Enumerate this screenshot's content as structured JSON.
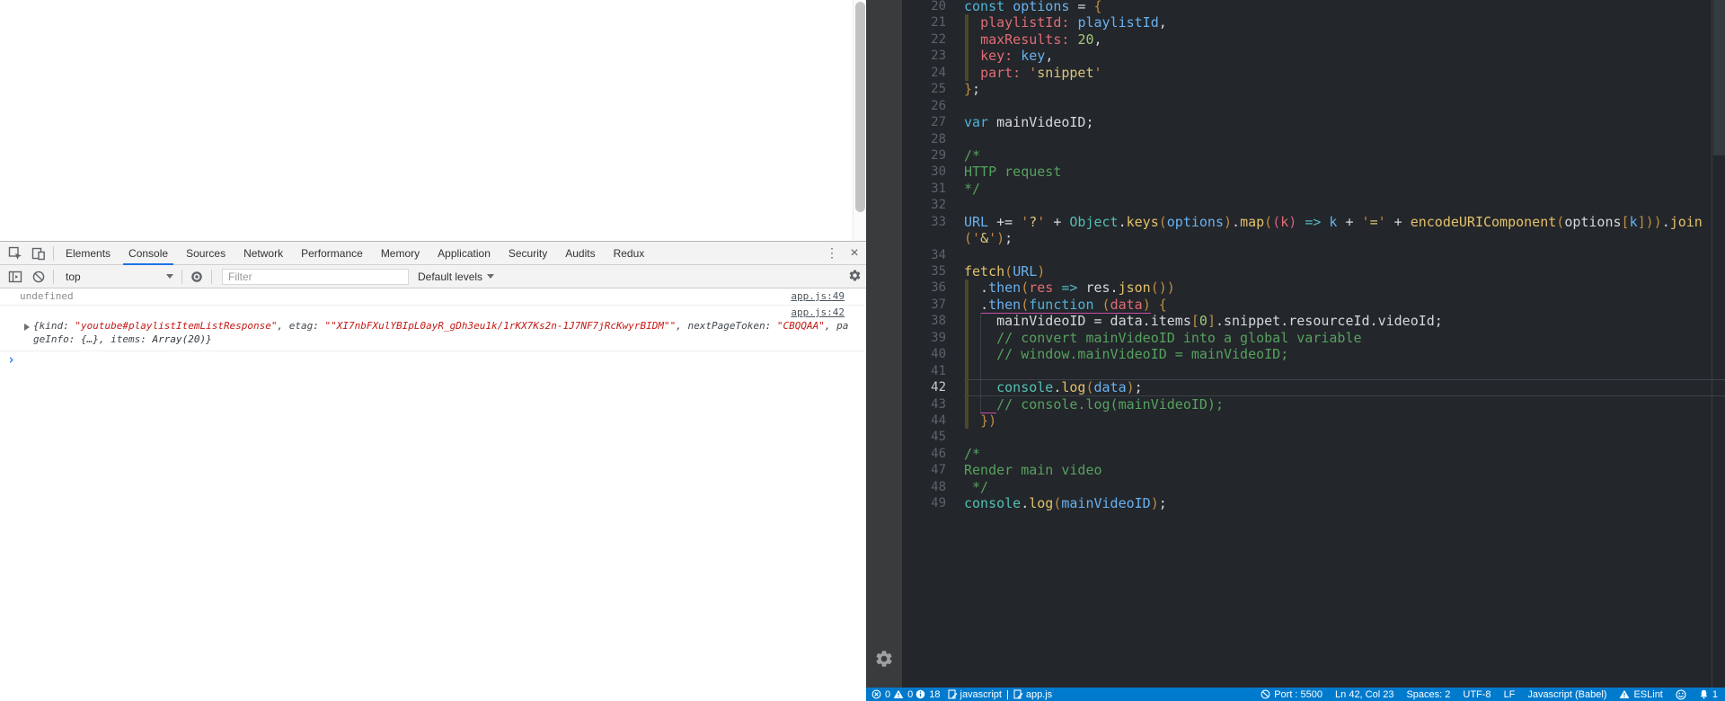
{
  "colors": {
    "statusbar_bg": "#007acc",
    "active_tab_underline": "#1a73e8",
    "editor_bg": "#23262a",
    "console_string": "#c41a16"
  },
  "icons": {
    "kebab": "⋮",
    "close": "×",
    "console_prompt": "›"
  },
  "devtools": {
    "tabs": [
      "Elements",
      "Console",
      "Sources",
      "Network",
      "Performance",
      "Memory",
      "Application",
      "Security",
      "Audits",
      "Redux"
    ],
    "active_tab": "Console",
    "toolbar": {
      "context": "top",
      "filter_placeholder": "Filter",
      "levels": "Default levels"
    },
    "console": {
      "row1": {
        "text": "undefined",
        "link": "app.js:49"
      },
      "row2": {
        "link": "app.js:42",
        "line1": [
          [
            "cp",
            "{"
          ],
          [
            "ck",
            "kind"
          ],
          [
            "cp",
            ": "
          ],
          [
            "cs",
            "\"youtube#playlistItemListResponse\""
          ],
          [
            "cp",
            ", "
          ],
          [
            "ck",
            "etag"
          ],
          [
            "cp",
            ": "
          ],
          [
            "cs",
            "\"\"XI7nbFXulYBIpL0ayR_gDh3eu1k/1rKX7Ks2n-1J7NF7jRcKwyrBIDM\"\""
          ],
          [
            "cp",
            ", "
          ],
          [
            "ck",
            "nextPageToken"
          ],
          [
            "cp",
            ": "
          ],
          [
            "cs",
            "\"CBQQAA\""
          ],
          [
            "cp",
            ", "
          ],
          [
            "ck",
            "pa"
          ]
        ],
        "line2": [
          [
            "ck",
            "geInfo"
          ],
          [
            "cp",
            ": {…}, "
          ],
          [
            "ck",
            "items"
          ],
          [
            "cp",
            ": "
          ],
          [
            "cp",
            "Array(20)"
          ],
          [
            "cp",
            "}"
          ]
        ]
      }
    }
  },
  "editor": {
    "lines": [
      {
        "n": "20",
        "g": "",
        "t": [
          [
            "k",
            "const"
          ],
          [
            "d",
            " "
          ],
          [
            "v",
            "options"
          ],
          [
            "d",
            " = "
          ],
          [
            "b",
            "{"
          ]
        ]
      },
      {
        "n": "21",
        "g": "o",
        "t": [
          [
            "d",
            "  "
          ],
          [
            "r",
            "playlistId:"
          ],
          [
            "d",
            " "
          ],
          [
            "v",
            "playlistId"
          ],
          [
            "d",
            ","
          ]
        ]
      },
      {
        "n": "22",
        "g": "o",
        "t": [
          [
            "d",
            "  "
          ],
          [
            "r",
            "maxResults:"
          ],
          [
            "d",
            " "
          ],
          [
            "n",
            "20"
          ],
          [
            "d",
            ","
          ]
        ]
      },
      {
        "n": "23",
        "g": "o",
        "t": [
          [
            "d",
            "  "
          ],
          [
            "r",
            "key:"
          ],
          [
            "d",
            " "
          ],
          [
            "v",
            "key"
          ],
          [
            "d",
            ","
          ]
        ]
      },
      {
        "n": "24",
        "g": "o",
        "t": [
          [
            "d",
            "  "
          ],
          [
            "r",
            "part:"
          ],
          [
            "d",
            " "
          ],
          [
            "q",
            "'"
          ],
          [
            "s",
            "snippet"
          ],
          [
            "q",
            "'"
          ]
        ]
      },
      {
        "n": "25",
        "g": "",
        "t": [
          [
            "b",
            "}"
          ],
          [
            "d",
            ";"
          ]
        ]
      },
      {
        "n": "26",
        "g": "",
        "t": []
      },
      {
        "n": "27",
        "g": "",
        "t": [
          [
            "k",
            "var"
          ],
          [
            "d",
            " mainVideoID;"
          ]
        ]
      },
      {
        "n": "28",
        "g": "",
        "t": []
      },
      {
        "n": "29",
        "g": "",
        "t": [
          [
            "c",
            "/*"
          ]
        ]
      },
      {
        "n": "30",
        "g": "",
        "t": [
          [
            "c",
            "HTTP request"
          ]
        ]
      },
      {
        "n": "31",
        "g": "",
        "t": [
          [
            "c",
            "*/"
          ]
        ]
      },
      {
        "n": "32",
        "g": "",
        "t": []
      },
      {
        "n": "33",
        "g": "",
        "t": [
          [
            "v",
            "URL"
          ],
          [
            "d",
            " += "
          ],
          [
            "q",
            "'"
          ],
          [
            "s",
            "?"
          ],
          [
            "q",
            "'"
          ],
          [
            "d",
            " + "
          ],
          [
            "t",
            "Object"
          ],
          [
            "d",
            "."
          ],
          [
            "m",
            "keys"
          ],
          [
            "b",
            "("
          ],
          [
            "v",
            "options"
          ],
          [
            "b",
            ")"
          ],
          [
            "d",
            "."
          ],
          [
            "m",
            "map"
          ],
          [
            "b",
            "("
          ],
          [
            "rb",
            "("
          ],
          [
            "r",
            "k"
          ],
          [
            "rb",
            ")"
          ],
          [
            "d",
            " "
          ],
          [
            "a",
            "=>"
          ],
          [
            "d",
            " "
          ],
          [
            "v",
            "k"
          ],
          [
            "d",
            " + "
          ],
          [
            "q",
            "'"
          ],
          [
            "s",
            "="
          ],
          [
            "q",
            "'"
          ],
          [
            "d",
            " + "
          ],
          [
            "m",
            "encodeURIComponent"
          ],
          [
            "b",
            "("
          ],
          [
            "d",
            "options"
          ],
          [
            "b",
            "["
          ],
          [
            "v",
            "k"
          ],
          [
            "b",
            "]"
          ],
          [
            "b",
            ")"
          ],
          [
            "b",
            ")"
          ],
          [
            "d",
            "."
          ],
          [
            "m",
            "join"
          ]
        ]
      },
      {
        "n": "",
        "g": "",
        "t": [
          [
            "b",
            "("
          ],
          [
            "q",
            "'"
          ],
          [
            "s",
            "&"
          ],
          [
            "q",
            "'"
          ],
          [
            "b",
            ")"
          ],
          [
            "d",
            ";"
          ]
        ]
      },
      {
        "n": "34",
        "g": "",
        "t": []
      },
      {
        "n": "35",
        "g": "",
        "t": [
          [
            "m",
            "fetch"
          ],
          [
            "b",
            "("
          ],
          [
            "v",
            "URL"
          ],
          [
            "b",
            ")"
          ]
        ]
      },
      {
        "n": "36",
        "g": "o",
        "t": [
          [
            "d",
            "  ."
          ],
          [
            "v",
            "then"
          ],
          [
            "b",
            "("
          ],
          [
            "r",
            "res"
          ],
          [
            "d",
            " "
          ],
          [
            "a",
            "=>"
          ],
          [
            "d",
            " res."
          ],
          [
            "m",
            "json"
          ],
          [
            "b",
            "()"
          ],
          [
            "b",
            ")"
          ]
        ]
      },
      {
        "n": "37",
        "g": "o",
        "t": [
          [
            "d",
            "  "
          ],
          [
            "d u",
            "."
          ],
          [
            "v u",
            "then"
          ],
          [
            "b u",
            "("
          ],
          [
            "k u",
            "function"
          ],
          [
            "d u",
            " "
          ],
          [
            "b u",
            "("
          ],
          [
            "r u",
            "data"
          ],
          [
            "b u",
            ")"
          ],
          [
            "d",
            " "
          ],
          [
            "b",
            "{"
          ]
        ]
      },
      {
        "n": "38",
        "g": "og",
        "t": [
          [
            "d",
            "    mainVideoID = data.items"
          ],
          [
            "b",
            "["
          ],
          [
            "n",
            "0"
          ],
          [
            "b",
            "]"
          ],
          [
            "d",
            ".snippet.resourceId.videoId;"
          ]
        ]
      },
      {
        "n": "39",
        "g": "og",
        "t": [
          [
            "c",
            "    // convert mainVideoID into a global variable"
          ]
        ]
      },
      {
        "n": "40",
        "g": "og",
        "t": [
          [
            "c",
            "    // window.mainVideoID = mainVideoID;"
          ]
        ]
      },
      {
        "n": "41",
        "g": "og",
        "t": []
      },
      {
        "n": "42",
        "g": "og",
        "cur": true,
        "t": [
          [
            "d",
            "    "
          ],
          [
            "t",
            "console"
          ],
          [
            "d",
            "."
          ],
          [
            "m",
            "log"
          ],
          [
            "b",
            "("
          ],
          [
            "v",
            "data"
          ],
          [
            "b",
            ")"
          ],
          [
            "d",
            ";"
          ]
        ]
      },
      {
        "n": "43",
        "g": "og",
        "t": [
          [
            "d",
            "  "
          ],
          [
            "e",
            "  "
          ],
          [
            "c",
            "// console.log(mainVideoID);"
          ]
        ]
      },
      {
        "n": "44",
        "g": "o",
        "t": [
          [
            "d",
            "  "
          ],
          [
            "b",
            "}"
          ],
          [
            "b",
            ")"
          ]
        ]
      },
      {
        "n": "45",
        "g": "",
        "t": []
      },
      {
        "n": "46",
        "g": "",
        "t": [
          [
            "c",
            "/*"
          ]
        ]
      },
      {
        "n": "47",
        "g": "",
        "t": [
          [
            "c",
            "Render main video"
          ]
        ]
      },
      {
        "n": "48",
        "g": "",
        "t": [
          [
            "c",
            " */"
          ]
        ]
      },
      {
        "n": "49",
        "g": "",
        "t": [
          [
            "t",
            "console"
          ],
          [
            "d",
            "."
          ],
          [
            "m",
            "log"
          ],
          [
            "b",
            "("
          ],
          [
            "v",
            "mainVideoID"
          ],
          [
            "b",
            ")"
          ],
          [
            "d",
            ";"
          ]
        ]
      }
    ]
  },
  "status_bar": {
    "errors": "0",
    "warnings": "0",
    "infos": "18",
    "lang_badge": "javascript",
    "pipe": "|",
    "file_badge": "app.js",
    "port": "Port : 5500",
    "position": "Ln 42, Col 23",
    "spaces": "Spaces: 2",
    "encoding": "UTF-8",
    "eol": "LF",
    "mode": "Javascript (Babel)",
    "eslint": "ESLint",
    "bell_count": "1"
  }
}
